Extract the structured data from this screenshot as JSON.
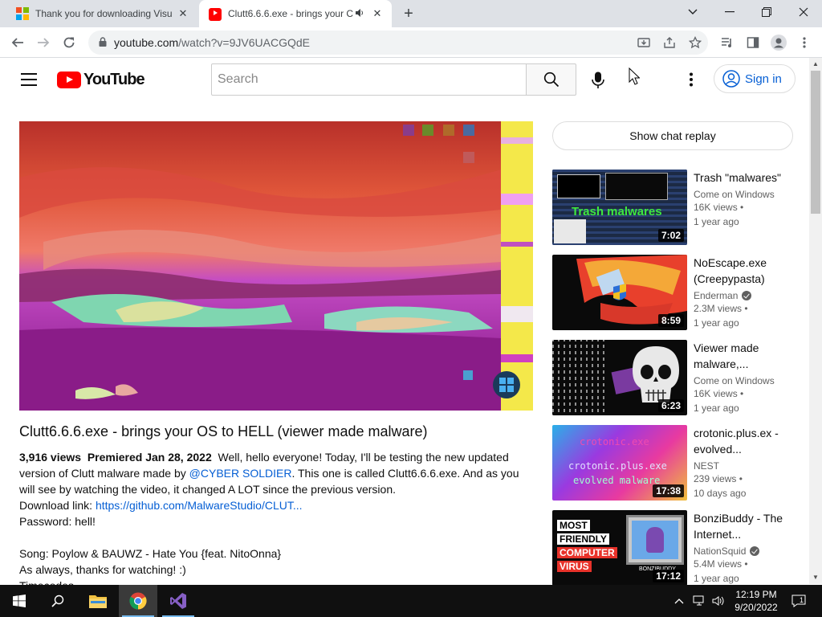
{
  "browser": {
    "tabs": [
      {
        "title": "Thank you for downloading Visu",
        "active": false
      },
      {
        "title": "Clutt6.6.6.exe - brings your C",
        "active": true
      }
    ],
    "url_host": "youtube.com",
    "url_path": "/watch?v=9JV6UACGQdE"
  },
  "youtube": {
    "logo_text": "YouTube",
    "search_placeholder": "Search",
    "sign_in_label": "Sign in"
  },
  "video": {
    "title": "Clutt6.6.6.exe - brings your OS to HELL (viewer made malware)",
    "views": "3,916 views",
    "premiered": "Premiered Jan 28, 2022",
    "desc_intro": "Well, hello everyone! Today, I'll be testing the new updated",
    "desc_line2_a": "version of Clutt malware made by",
    "desc_mention": "@CYBER SOLDIER",
    "desc_line2_b": ". This one is called Clutt6.6.6.exe. And as you",
    "desc_line3": "will see by watching the video, it changed A LOT since the previous version.",
    "download_label": "Download link:",
    "download_link": "https://github.com/MalwareStudio/CLUT...",
    "password": "Password: hell!",
    "song": "Song: Poylow & BAUWZ - Hate You {feat. NitoOnna}",
    "thanks": "As always, thanks for watching! :)",
    "timecodes": "Timecodes"
  },
  "sidebar": {
    "chat_replay_label": "Show chat replay",
    "recommendations": [
      {
        "title": "Trash \"malwares\"",
        "channel": "Come on Windows",
        "verified": false,
        "views": "16K views",
        "age": "1 year ago",
        "duration": "7:02",
        "thumb_text": "Trash malwares"
      },
      {
        "title": "NoEscape.exe (Creepypasta)",
        "channel": "Enderman",
        "verified": true,
        "views": "2.3M views",
        "age": "1 year ago",
        "duration": "8:59"
      },
      {
        "title": "Viewer made malware,...",
        "channel": "Come on Windows",
        "verified": false,
        "views": "16K views",
        "age": "1 year ago",
        "duration": "6:23"
      },
      {
        "title": "crotonic.plus.ex - evolved...",
        "channel": "NEST",
        "verified": false,
        "views": "239 views",
        "age": "10 days ago",
        "duration": "17:38",
        "thumb_text_1": "crotonic.exe",
        "thumb_text_2": "crotonic.plus.exe",
        "thumb_text_3": "evolved malware"
      },
      {
        "title": "BonziBuddy - The Internet...",
        "channel": "NationSquid",
        "verified": true,
        "views": "5.4M views",
        "age": "1 year ago",
        "duration": "17:12",
        "thumb_words": [
          "MOST",
          "FRIENDLY",
          "COMPUTER",
          "VIRUS"
        ],
        "thumb_badge": "BONZIBUDDY"
      }
    ]
  },
  "taskbar": {
    "time": "12:19 PM",
    "date": "9/20/2022",
    "notification_count": "1"
  },
  "colors": {
    "yt_red": "#ff0000",
    "link_blue": "#065fd4",
    "taskbar": "#101010"
  }
}
